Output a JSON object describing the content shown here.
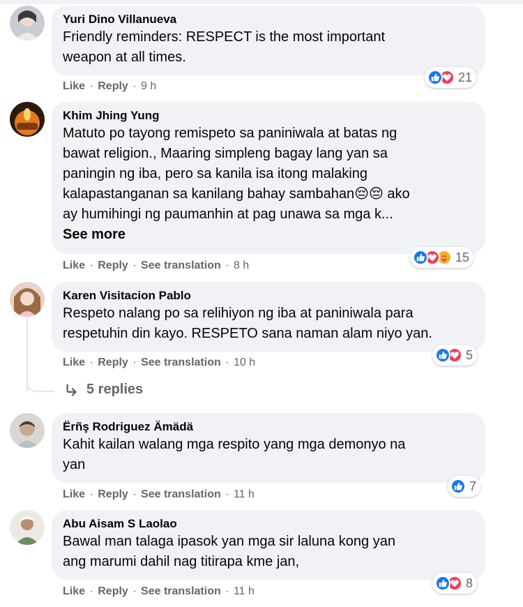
{
  "comments": [
    {
      "author": "Yuri Dino Villanueva",
      "text": "Friendly reminders: RESPECT is the most important\nweapon at all times.",
      "like": "Like",
      "reply": "Reply",
      "time": "9 h",
      "reaction_icons": [
        "like-icon",
        "love-icon"
      ],
      "reaction_count": "21"
    },
    {
      "author": "Khim Jhing Yung",
      "text": "Matuto po tayong remispeto sa paniniwala at batas ng\nbawat religion., Maaring simpleng bagay lang yan sa\npaningin ng iba, pero sa kanila isa itong malaking\nkalapastanganan sa kanilang bahay sambahan😔😔 ako\nay humihingi ng paumanhin at pag unawa sa mga k...",
      "see_more": "See more",
      "like": "Like",
      "reply": "Reply",
      "translate": "See translation",
      "time": "8 h",
      "reaction_icons": [
        "like-icon",
        "love-icon",
        "care-icon"
      ],
      "reaction_count": "15"
    },
    {
      "author": "Karen Visitacion Pablo",
      "text": "Respeto nalang po sa relihiyon ng iba at paniniwala para\nrespetuhin din kayo. RESPETO sana naman alam niyo yan.",
      "like": "Like",
      "reply": "Reply",
      "translate": "See translation",
      "time": "10 h",
      "reaction_icons": [
        "like-icon",
        "love-icon"
      ],
      "reaction_count": "5"
    },
    {
      "author": "Ërñş Rodriguez Ämädä",
      "text": "Kahit kailan walang mga respito yang mga demonyo na\nyan",
      "like": "Like",
      "reply": "Reply",
      "translate": "See translation",
      "time": "11 h",
      "reaction_icons": [
        "like-icon"
      ],
      "reaction_count": "7"
    },
    {
      "author": "Abu Aisam S Laolao",
      "text": "Bawal man talaga ipasok yan mga sir laluna kong yan\nang marumi dahil nag titirapa kme jan,",
      "like": "Like",
      "reply": "Reply",
      "translate": "See translation",
      "time": "11 h",
      "reaction_icons": [
        "like-icon",
        "love-icon"
      ],
      "reaction_count": "8"
    }
  ],
  "replies_link": "5 replies",
  "colors": {
    "like": "#1877f2",
    "love": "#f33e58",
    "care": "#f7b125",
    "bubble": "#f0f2f5",
    "meta": "#65676b"
  }
}
